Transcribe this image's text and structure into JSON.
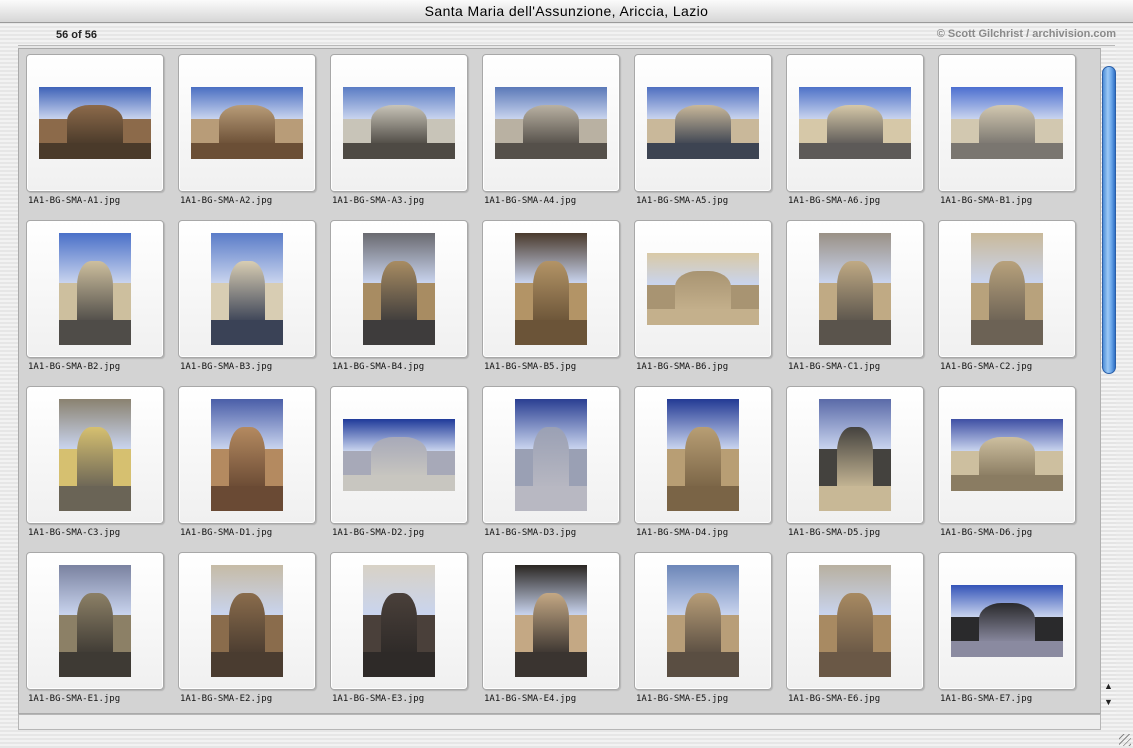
{
  "window": {
    "title": "Santa Maria dell'Assunzione, Ariccia, Lazio"
  },
  "header": {
    "count": "56 of 56",
    "copyright": "© Scott Gilchrist / archivision.com"
  },
  "colors": {
    "scroll_thumb": "#4d8ed8",
    "panel_bg": "#d3d3d3"
  },
  "scrollbar": {
    "up_icon": "triangle-up",
    "down_icon": "triangle-down"
  },
  "thumbnails": [
    {
      "name": "1A1-BG-SMA-A1.jpg",
      "orient": "land",
      "sky": "#3f63b8",
      "mass": "#8c6a4a",
      "ground": "#4a3a2a"
    },
    {
      "name": "1A1-BG-SMA-A2.jpg",
      "orient": "land",
      "sky": "#4a6fc2",
      "mass": "#b89c78",
      "ground": "#6b4f36"
    },
    {
      "name": "1A1-BG-SMA-A3.jpg",
      "orient": "land",
      "sky": "#5a7cc4",
      "mass": "#c8c4b8",
      "ground": "#4e4a44"
    },
    {
      "name": "1A1-BG-SMA-A4.jpg",
      "orient": "land",
      "sky": "#5b79b8",
      "mass": "#b9b1a2",
      "ground": "#55504a"
    },
    {
      "name": "1A1-BG-SMA-A5.jpg",
      "orient": "land",
      "sky": "#4f6fc0",
      "mass": "#c9b89a",
      "ground": "#3d4452"
    },
    {
      "name": "1A1-BG-SMA-A6.jpg",
      "orient": "land",
      "sky": "#4e72c8",
      "mass": "#d6c8a8",
      "ground": "#5d5a58"
    },
    {
      "name": "1A1-BG-SMA-B1.jpg",
      "orient": "land",
      "sky": "#4c6fd0",
      "mass": "#d2c8b0",
      "ground": "#7a7670"
    },
    {
      "name": "1A1-BG-SMA-B2.jpg",
      "orient": "port",
      "sky": "#4a70c8",
      "mass": "#cdbf9e",
      "ground": "#4f4c48"
    },
    {
      "name": "1A1-BG-SMA-B3.jpg",
      "orient": "port",
      "sky": "#5a7cc8",
      "mass": "#d8cdb3",
      "ground": "#3a4256"
    },
    {
      "name": "1A1-BG-SMA-B4.jpg",
      "orient": "port",
      "sky": "#6a6a70",
      "mass": "#a88c62",
      "ground": "#3e3c3c"
    },
    {
      "name": "1A1-BG-SMA-B5.jpg",
      "orient": "port",
      "sky": "#4a3a2c",
      "mass": "#b39466",
      "ground": "#6b5438"
    },
    {
      "name": "1A1-BG-SMA-B6.jpg",
      "orient": "land",
      "sky": "#d9c9a6",
      "mass": "#a89472",
      "ground": "#c4b08c"
    },
    {
      "name": "1A1-BG-SMA-C1.jpg",
      "orient": "port",
      "sky": "#9a9186",
      "mass": "#c0aa84",
      "ground": "#5a544c"
    },
    {
      "name": "1A1-BG-SMA-C2.jpg",
      "orient": "port",
      "sky": "#c9b99a",
      "mass": "#b8a27c",
      "ground": "#6c6255"
    },
    {
      "name": "1A1-BG-SMA-C3.jpg",
      "orient": "port",
      "sky": "#8a8270",
      "mass": "#d6c070",
      "ground": "#6a6456"
    },
    {
      "name": "1A1-BG-SMA-D1.jpg",
      "orient": "port",
      "sky": "#4a5ea8",
      "mass": "#b48a60",
      "ground": "#6a4a34"
    },
    {
      "name": "1A1-BG-SMA-D2.jpg",
      "orient": "land",
      "sky": "#1f3a9a",
      "mass": "#a7a9b8",
      "ground": "#c8c6c0"
    },
    {
      "name": "1A1-BG-SMA-D3.jpg",
      "orient": "port",
      "sky": "#2a3f92",
      "mass": "#9aa0b4",
      "ground": "#b8b8c2"
    },
    {
      "name": "1A1-BG-SMA-D4.jpg",
      "orient": "port",
      "sky": "#233a94",
      "mass": "#b89e74",
      "ground": "#7a6446"
    },
    {
      "name": "1A1-BG-SMA-D5.jpg",
      "orient": "port",
      "sky": "#5a6aa8",
      "mass": "#44423e",
      "ground": "#c8b896"
    },
    {
      "name": "1A1-BG-SMA-D6.jpg",
      "orient": "land",
      "sky": "#3e4fa4",
      "mass": "#cdbf9f",
      "ground": "#8a7c62"
    },
    {
      "name": "1A1-BG-SMA-E1.jpg",
      "orient": "port",
      "sky": "#7a82a0",
      "mass": "#8c8066",
      "ground": "#3e3a34"
    },
    {
      "name": "1A1-BG-SMA-E2.jpg",
      "orient": "port",
      "sky": "#c6bba6",
      "mass": "#8a6c4c",
      "ground": "#4a3c30"
    },
    {
      "name": "1A1-BG-SMA-E3.jpg",
      "orient": "port",
      "sky": "#d8d2c6",
      "mass": "#4a403a",
      "ground": "#2e2a28"
    },
    {
      "name": "1A1-BG-SMA-E4.jpg",
      "orient": "port",
      "sky": "#2a2622",
      "mass": "#c4a884",
      "ground": "#3a3430"
    },
    {
      "name": "1A1-BG-SMA-E5.jpg",
      "orient": "port",
      "sky": "#6c86b8",
      "mass": "#b89e78",
      "ground": "#5a4e42"
    },
    {
      "name": "1A1-BG-SMA-E6.jpg",
      "orient": "port",
      "sky": "#b8b0a0",
      "mass": "#a88a62",
      "ground": "#6a5846"
    },
    {
      "name": "1A1-BG-SMA-E7.jpg",
      "orient": "land",
      "sky": "#3454b8",
      "mass": "#2a2a2c",
      "ground": "#8a8aa0"
    }
  ]
}
